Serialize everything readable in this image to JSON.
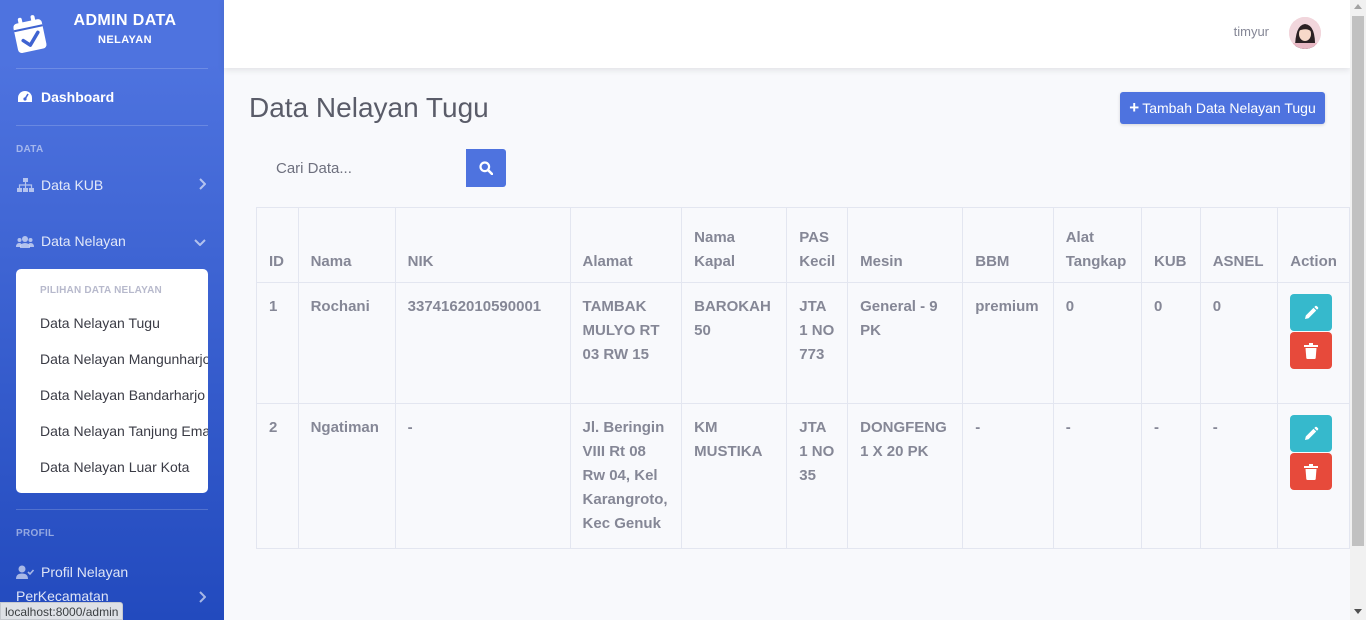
{
  "sidebar": {
    "brand": {
      "line1": "ADMIN DATA",
      "line2": "NELAYAN"
    },
    "dashboard": "Dashboard",
    "heading_data": "DATA",
    "data_kub": "Data KUB",
    "data_nelayan": "Data Nelayan",
    "collapse": {
      "header": "PILIHAN DATA NELAYAN",
      "items": [
        "Data Nelayan Tugu",
        "Data Nelayan Mangunharjo",
        "Data Nelayan Bandarharjo",
        "Data Nelayan Tanjung Emas",
        "Data Nelayan Luar Kota"
      ]
    },
    "heading_profil": "PROFIL",
    "profil": {
      "line1": "Profil Nelayan",
      "line2": "PerKecamatan"
    }
  },
  "status_bar": "localhost:8000/admin",
  "topbar": {
    "user": "timyur"
  },
  "main": {
    "title": "Data Nelayan Tugu",
    "add_button": "Tambah Data Nelayan Tugu",
    "search_placeholder": "Cari Data..."
  },
  "table": {
    "headers": [
      "ID",
      "Nama",
      "NIK",
      "Alamat",
      "Nama Kapal",
      "PAS Kecil",
      "Mesin",
      "BBM",
      "Alat Tangkap",
      "KUB",
      "ASNEL",
      "Action"
    ],
    "rows": [
      [
        "1",
        "Rochani",
        "3374162010590001",
        "TAMBAK MULYO RT 03 RW 15",
        "BAROKAH 50",
        "JTA 1 NO 773",
        "General - 9 PK",
        "premium",
        "0",
        "0",
        "0"
      ],
      [
        "2",
        "Ngatiman",
        "-",
        "Jl. Beringin VIII Rt 08 Rw 04, Kel Karangroto, Kec Genuk",
        "KM MUSTIKA",
        "JTA 1 NO 35",
        "DONGFENG 1 X 20 PK",
        "-",
        "-",
        "-",
        "-"
      ]
    ]
  },
  "colors": {
    "primary": "#4e73df",
    "info": "#36b9cc",
    "danger": "#e74a3b",
    "text": "#858796"
  },
  "icons": [
    "calendar-check-icon",
    "tachometer-icon",
    "sitemap-icon",
    "users-icon",
    "user-check-icon",
    "chevron-right-icon",
    "chevron-down-icon",
    "search-icon",
    "plus-icon",
    "pencil-icon",
    "trash-icon"
  ]
}
